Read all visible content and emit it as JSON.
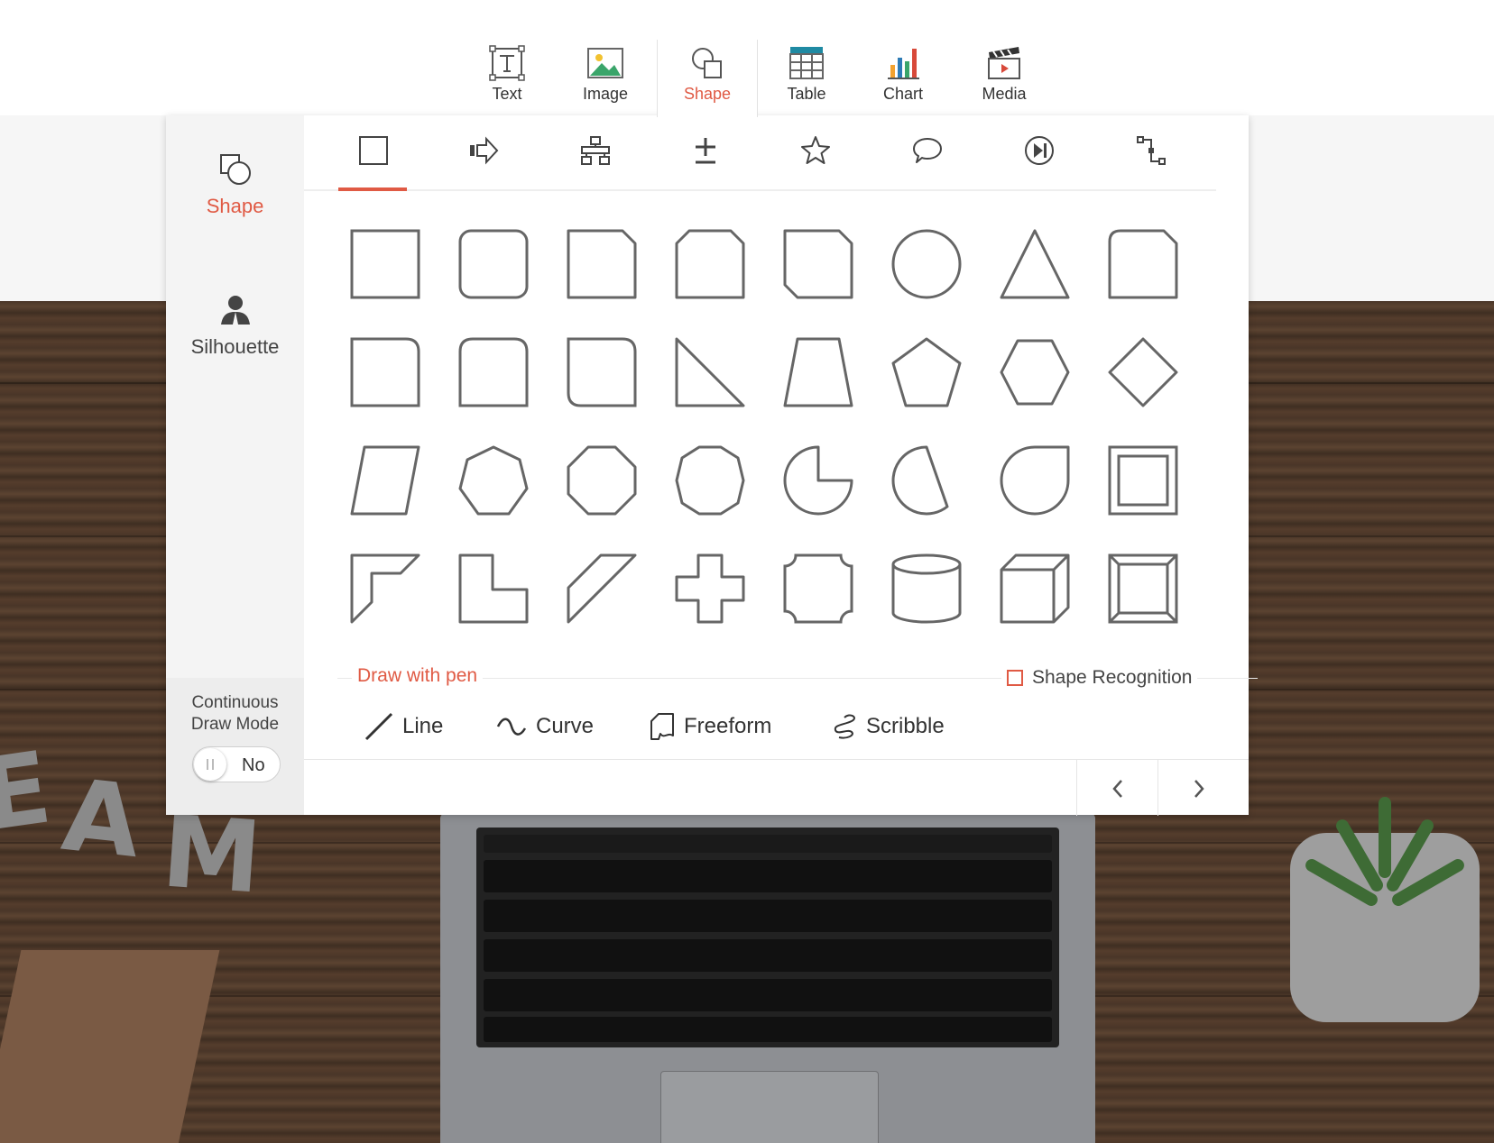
{
  "toolbar": {
    "items": [
      {
        "label": "Text",
        "icon": "text-icon"
      },
      {
        "label": "Image",
        "icon": "image-icon"
      },
      {
        "label": "Shape",
        "icon": "shape-icon",
        "active": true
      },
      {
        "label": "Table",
        "icon": "table-icon"
      },
      {
        "label": "Chart",
        "icon": "chart-icon"
      },
      {
        "label": "Media",
        "icon": "media-icon"
      }
    ]
  },
  "sidebar": {
    "categories": [
      {
        "label": "Shape",
        "icon": "shape-icon",
        "active": true
      },
      {
        "label": "Silhouette",
        "icon": "silhouette-icon"
      }
    ],
    "continuous_draw_mode": {
      "label": "Continuous\nDraw Mode",
      "value": "No"
    }
  },
  "shape_tabs": [
    {
      "icon": "basic-shapes-icon",
      "active": true
    },
    {
      "icon": "arrow-shapes-icon"
    },
    {
      "icon": "flowchart-icon"
    },
    {
      "icon": "math-shapes-icon"
    },
    {
      "icon": "star-icon"
    },
    {
      "icon": "callout-icon"
    },
    {
      "icon": "action-button-icon"
    },
    {
      "icon": "connector-icon"
    }
  ],
  "shapes": [
    "rectangle",
    "rounded-rectangle",
    "snip-single-corner-rectangle",
    "snip-same-side-rectangle",
    "snip-diagonal-rectangle",
    "circle",
    "triangle",
    "round-snip-rectangle",
    "round-single-corner-rectangle",
    "round-same-side-rectangle",
    "round-diagonal-rectangle",
    "right-triangle",
    "trapezoid",
    "pentagon",
    "hexagon",
    "diamond",
    "parallelogram",
    "heptagon",
    "octagon",
    "decagon",
    "pie",
    "chord",
    "teardrop",
    "frame",
    "half-frame",
    "l-shape",
    "diagonal-stripe",
    "cross",
    "plaque",
    "can",
    "cube",
    "bevel"
  ],
  "draw_with_pen": {
    "label": "Draw with pen",
    "tools": [
      {
        "label": "Line",
        "icon": "line-icon"
      },
      {
        "label": "Curve",
        "icon": "curve-icon"
      },
      {
        "label": "Freeform",
        "icon": "freeform-icon"
      },
      {
        "label": "Scribble",
        "icon": "scribble-icon"
      }
    ]
  },
  "shape_recognition": {
    "label": "Shape Recognition",
    "checked": false
  },
  "pagination": {
    "prev_icon": "chevron-left-icon",
    "next_icon": "chevron-right-icon"
  },
  "colors": {
    "accent": "#e05a44",
    "stroke": "#666666"
  }
}
